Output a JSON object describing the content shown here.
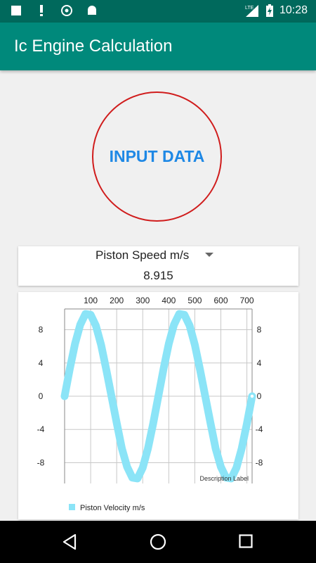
{
  "status_bar": {
    "time": "10:28",
    "network": "LTE",
    "icons": [
      "square-notification-icon",
      "exclamation-icon",
      "cast-icon",
      "android-icon",
      "lte-signal-icon",
      "battery-charging-icon"
    ]
  },
  "app_bar": {
    "title": "Ic Engine Calculation"
  },
  "input_button": {
    "label": "INPUT DATA",
    "border_color": "#d01c1c",
    "text_color": "#1e88e5"
  },
  "result": {
    "selected": "Piston Speed  m/s",
    "value": "8.915"
  },
  "chart_data": {
    "type": "line",
    "title": "",
    "description_label": "Description Label",
    "x_ticks": [
      100,
      200,
      300,
      400,
      500,
      600,
      700
    ],
    "y_ticks": [
      8,
      4,
      0,
      -4,
      -8
    ],
    "xlim": [
      0,
      720
    ],
    "ylim": [
      -10.5,
      10.5
    ],
    "axis_position_x": "top",
    "y_axis": "both-sides",
    "grid": true,
    "legend": "bottom-left",
    "series": [
      {
        "name": "Piston Velocity m/s",
        "color": "#8be4f7",
        "x": [
          0,
          20,
          40,
          60,
          80,
          100,
          120,
          140,
          160,
          180,
          200,
          220,
          240,
          260,
          280,
          300,
          320,
          340,
          360,
          380,
          400,
          420,
          440,
          460,
          480,
          500,
          520,
          540,
          560,
          580,
          600,
          620,
          640,
          660,
          680,
          700,
          720
        ],
        "y": [
          0.0,
          3.3,
          6.3,
          8.6,
          9.9,
          9.8,
          8.5,
          6.2,
          3.2,
          0.0,
          -3.2,
          -6.3,
          -8.5,
          -9.8,
          -9.9,
          -8.6,
          -6.3,
          -3.3,
          0.0,
          3.3,
          6.3,
          8.6,
          9.9,
          9.8,
          8.5,
          6.2,
          3.2,
          0.0,
          -3.2,
          -6.3,
          -8.5,
          -9.8,
          -9.9,
          -8.6,
          -6.3,
          -3.3,
          0.0
        ]
      }
    ]
  },
  "nav_bar": {
    "icons": [
      "back-icon",
      "home-icon",
      "recents-icon"
    ]
  }
}
